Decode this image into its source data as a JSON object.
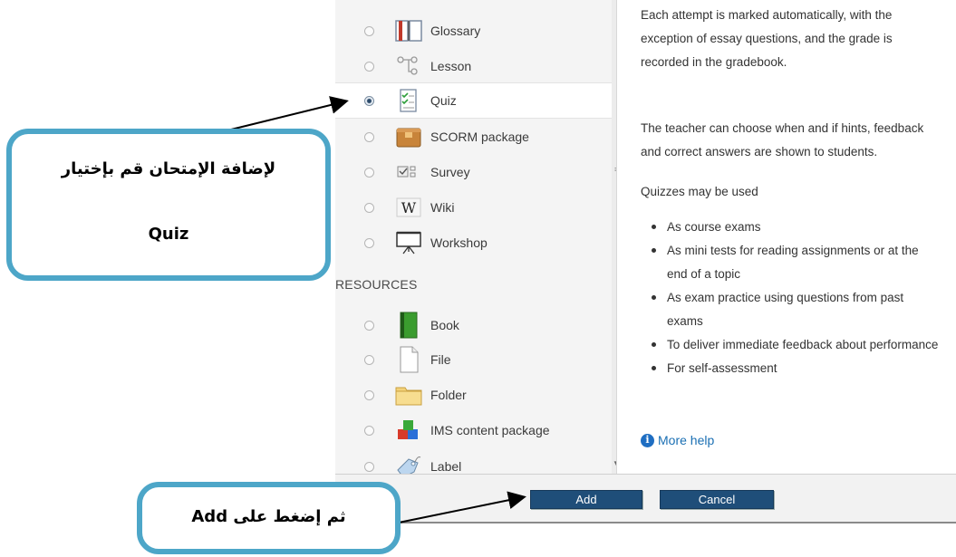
{
  "activities": [
    {
      "label": "Glossary",
      "icon": "glossary-icon",
      "selected": false
    },
    {
      "label": "Lesson",
      "icon": "lesson-icon",
      "selected": false
    },
    {
      "label": "Quiz",
      "icon": "quiz-icon",
      "selected": true
    },
    {
      "label": "SCORM package",
      "icon": "scorm-package-icon",
      "selected": false
    },
    {
      "label": "Survey",
      "icon": "survey-icon",
      "selected": false
    },
    {
      "label": "Wiki",
      "icon": "wiki-icon",
      "selected": false
    },
    {
      "label": "Workshop",
      "icon": "workshop-icon",
      "selected": false
    }
  ],
  "resources_heading": "RESOURCES",
  "resources": [
    {
      "label": "Book",
      "icon": "book-icon"
    },
    {
      "label": "File",
      "icon": "file-icon"
    },
    {
      "label": "Folder",
      "icon": "folder-icon"
    },
    {
      "label": "IMS content package",
      "icon": "ims-content-package-icon"
    },
    {
      "label": "Label",
      "icon": "label-icon"
    }
  ],
  "description": {
    "para1": "Each attempt is marked automatically, with the exception of essay questions, and the grade is recorded in the gradebook.",
    "para2": "The teacher can choose when and if hints, feedback and correct answers are shown to students.",
    "para3": "Quizzes may be used",
    "bullets": [
      "As course exams",
      "As mini tests for reading assignments or at the end of a topic",
      "As exam practice using questions from past exams",
      "To deliver immediate feedback about performance",
      "For self-assessment"
    ],
    "more_help": "More help"
  },
  "buttons": {
    "add": "Add",
    "cancel": "Cancel"
  },
  "callouts": {
    "quiz_line1": "لإضافة الإمتحان قم بإختيار",
    "quiz_line2": "Quiz",
    "add": "ثم إضغط على Add"
  },
  "colors": {
    "button": "#1f4e79",
    "callout_border": "#4da6c8",
    "link": "#1a6fb3"
  }
}
